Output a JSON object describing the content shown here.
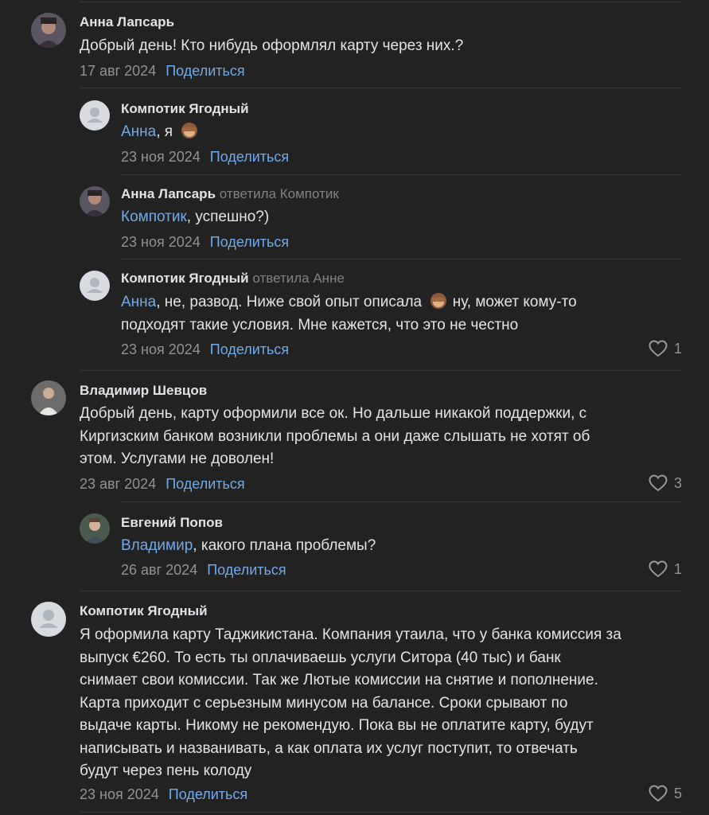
{
  "share_label": "Поделиться",
  "comments": [
    {
      "author": "Анна Лапсарь",
      "text": "Добрый день! Кто нибудь оформлял карту через них.?",
      "date": "17 авг 2024"
    },
    {
      "author": "Компотик Ягодный",
      "mention": "Анна",
      "text": ", я",
      "date": "23 ноя 2024"
    },
    {
      "author": "Анна Лапсарь",
      "reply_to": "ответила Компотик",
      "mention": "Компотик",
      "text": ", успешно?)",
      "date": "23 ноя 2024"
    },
    {
      "author": "Компотик Ягодный",
      "reply_to": "ответила Анне",
      "mention": "Анна",
      "text_line1": ", не, развод. Ниже свой опыт описала",
      "text_line1_end": "ну, может кому-то",
      "text_line2": "подходят такие условия. Мне кажется, что это не честно",
      "date": "23 ноя 2024",
      "likes": "1"
    },
    {
      "author": "Владимир Шевцов",
      "lines": [
        "Добрый день, карту оформили все ок. Но дальше никакой поддержки, с",
        "Киргизским банком возникли проблемы а они даже слышать не хотят об",
        "этом. Услугами не доволен!"
      ],
      "date": "23 авг 2024",
      "likes": "3"
    },
    {
      "author": "Евгений Попов",
      "mention": "Владимир",
      "text": ", какого плана проблемы?",
      "date": "26 авг 2024",
      "likes": "1"
    },
    {
      "author": "Компотик Ягодный",
      "lines": [
        "Я оформила карту Таджикистана. Компания утаила, что у банка комиссия за",
        "выпуск €260. То есть ты оплачиваешь услуги Ситора (40 тыс) и банк",
        "снимает свои комиссии. Так же Лютые комиссии на снятие и пополнение.",
        "Карта приходит с серьезным минусом на балансе. Сроки срывают по",
        "выдаче карты. Никому не рекомендую. Пока вы не оплатите карту, будут",
        "написывать и названивать, а как оплата их услуг поступит, то отвечать",
        "будут через пень колоду"
      ],
      "date": "23 ноя 2024",
      "likes": "5"
    }
  ]
}
